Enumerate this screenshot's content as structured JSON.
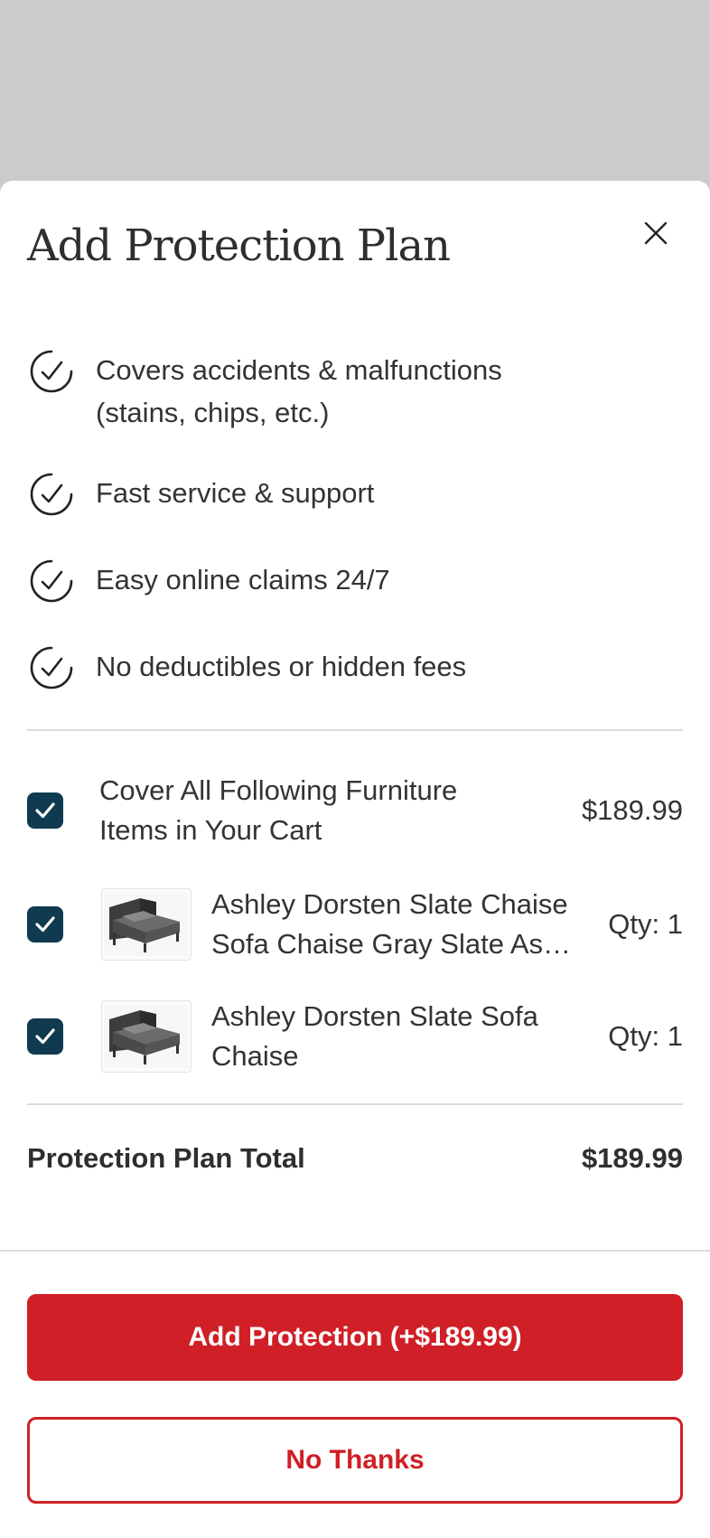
{
  "modal": {
    "title": "Add Protection Plan",
    "close_icon": "close-icon"
  },
  "benefits": [
    {
      "line1": "Covers accidents & malfunctions",
      "line2": "(stains, chips, etc.)",
      "icon": "check-circle-icon"
    },
    {
      "line1": "Fast service & support",
      "icon": "check-circle-icon"
    },
    {
      "line1": "Easy online claims 24/7",
      "icon": "check-circle-icon"
    },
    {
      "line1": "No deductibles or hidden fees",
      "icon": "check-circle-icon"
    }
  ],
  "cover_all": {
    "checked": true,
    "line1": "Cover All Following Furniture",
    "line2": "Items in Your Cart",
    "price": "$189.99"
  },
  "items": [
    {
      "checked": true,
      "name_line1": "Ashley Dorsten Slate Chaise",
      "name_line2": "Sofa Chaise Gray Slate Ashley Dorsten",
      "qty": "Qty: 1"
    },
    {
      "checked": true,
      "name_line1": "Ashley Dorsten Slate Sofa",
      "name_line2": "Chaise",
      "qty": "Qty: 1"
    }
  ],
  "total": {
    "label": "Protection Plan Total",
    "value": "$189.99"
  },
  "actions": {
    "add_label": "Add Protection (+$189.99)",
    "no_thanks_label": "No Thanks"
  },
  "colors": {
    "primary_red": "#d01f26",
    "checkbox_navy": "#0f3a4f",
    "backdrop_gray": "#cbcbcb"
  }
}
